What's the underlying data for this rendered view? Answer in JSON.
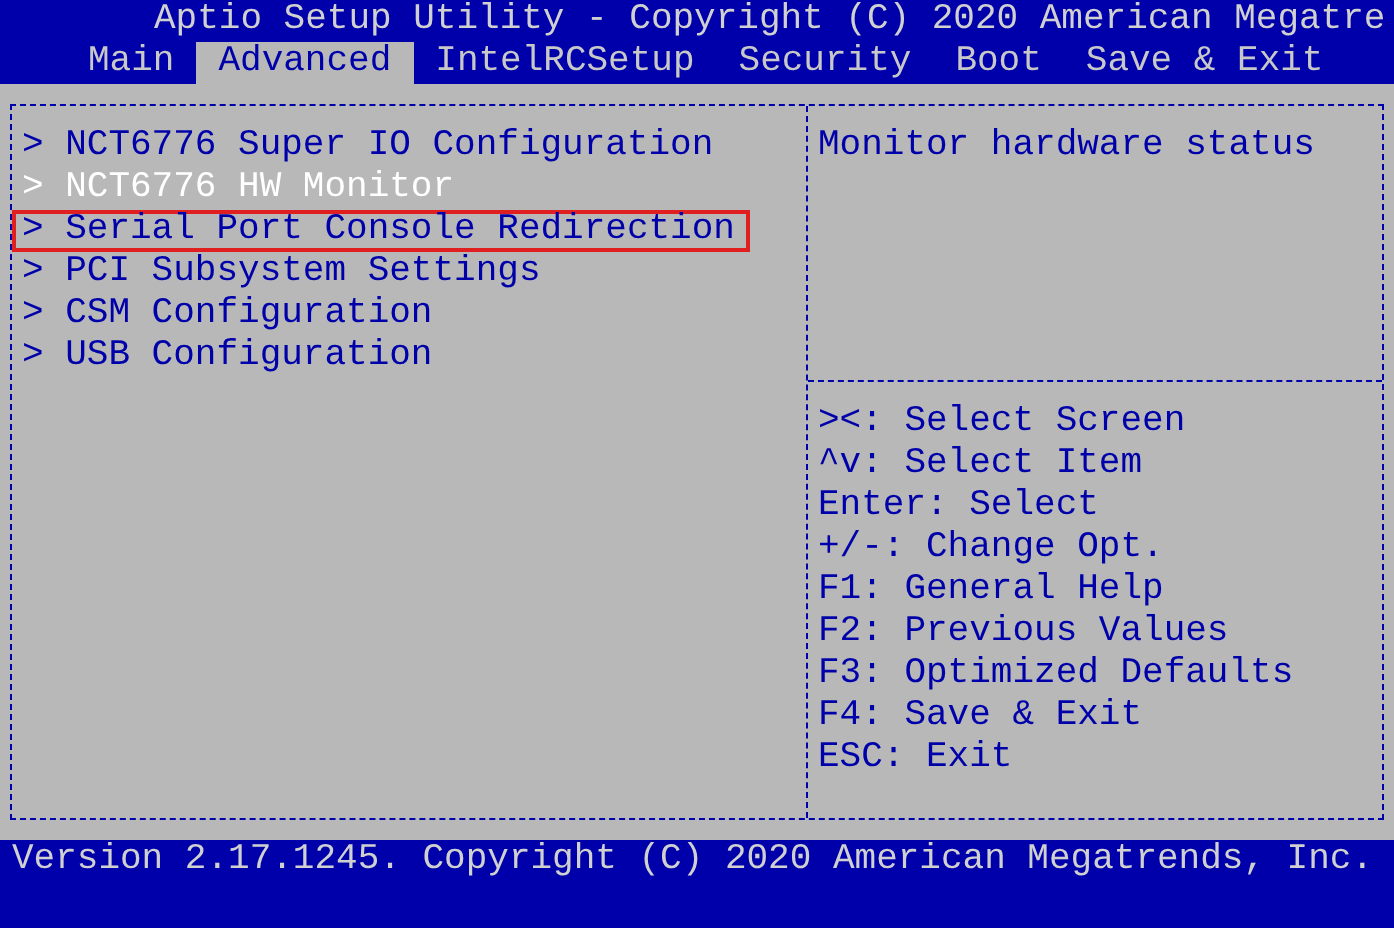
{
  "window": {
    "title": "Aptio Setup Utility - Copyright (C) 2020 American Megatre"
  },
  "tabs": [
    {
      "label": "Main",
      "selected": false
    },
    {
      "label": "Advanced",
      "selected": true
    },
    {
      "label": "IntelRCSetup",
      "selected": false
    },
    {
      "label": "Security",
      "selected": false
    },
    {
      "label": "Boot",
      "selected": false
    },
    {
      "label": "Save & Exit",
      "selected": false
    }
  ],
  "menu": {
    "items": [
      {
        "label": "> NCT6776 Super IO Configuration",
        "selected": false,
        "outlined": false
      },
      {
        "label": "> NCT6776 HW Monitor",
        "selected": true,
        "outlined": false
      },
      {
        "label": "> Serial Port Console Redirection",
        "selected": false,
        "outlined": true
      },
      {
        "label": "> PCI Subsystem Settings",
        "selected": false,
        "outlined": false
      },
      {
        "label": "> CSM Configuration",
        "selected": false,
        "outlined": false
      },
      {
        "label": "> USB Configuration",
        "selected": false,
        "outlined": false
      }
    ]
  },
  "help": {
    "description": "Monitor hardware status",
    "keys": [
      "><: Select Screen",
      "^v: Select Item",
      "Enter: Select",
      "+/-: Change Opt.",
      "F1: General Help",
      "F2: Previous Values",
      "F3: Optimized Defaults",
      "F4: Save & Exit",
      "ESC: Exit"
    ]
  },
  "status_bar": {
    "text": "Version 2.17.1245. Copyright (C) 2020 American Megatrends, Inc."
  }
}
